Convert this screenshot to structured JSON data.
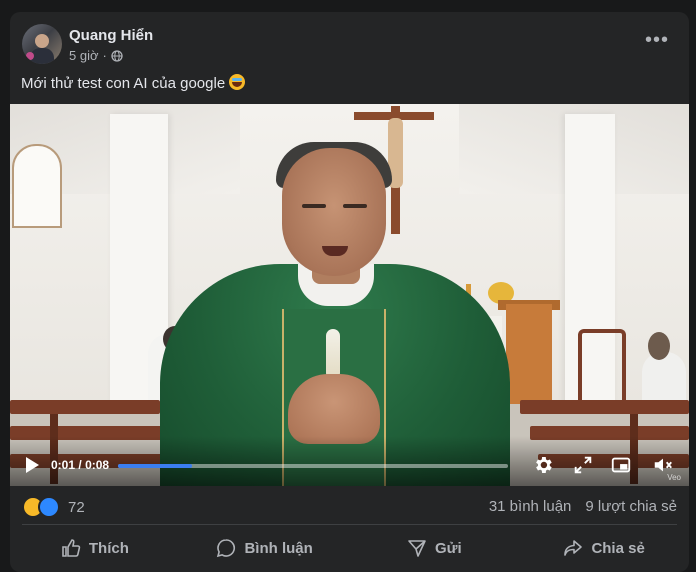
{
  "post": {
    "author": "Quang Hiển",
    "time": "5 giờ",
    "separator": "·",
    "caption": "Mới thử test con AI của google",
    "more": "•••"
  },
  "video": {
    "current_time": "0:01",
    "time_separator": "/",
    "duration": "0:08",
    "progress": 0.19,
    "watermark": "Veo"
  },
  "reactions": {
    "count": "72",
    "comments": "31 bình luận",
    "shares": "9 lượt chia sẻ"
  },
  "actions": {
    "like": "Thích",
    "comment": "Bình luận",
    "send": "Gửi",
    "share": "Chia sẻ"
  },
  "colors": {
    "background": "#18191a",
    "card": "#242526",
    "progress": "#3b7ef0",
    "secondary_text": "#b0b3b8"
  }
}
